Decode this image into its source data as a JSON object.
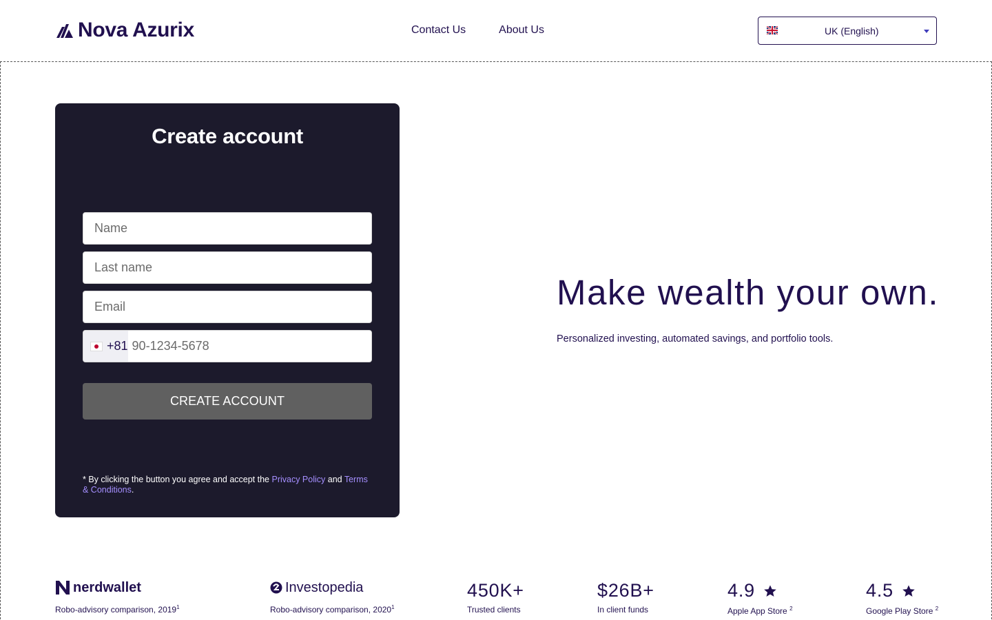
{
  "header": {
    "brand": "Nova Azurix",
    "nav": [
      {
        "label": "Contact Us"
      },
      {
        "label": "About Us"
      }
    ],
    "language": {
      "value": "UK (English)",
      "flag": "uk-flag-icon"
    }
  },
  "form": {
    "title": "Create account",
    "name_placeholder": "Name",
    "lastname_placeholder": "Last name",
    "email_placeholder": "Email",
    "phone_code": "+81",
    "phone_placeholder": "90-1234-5678",
    "submit_label": "CREATE ACCOUNT",
    "legal_prefix": "* By clicking the button you agree and accept the ",
    "privacy_link": "Privacy Policy",
    "legal_and": " and ",
    "terms_link": "Terms & Conditions",
    "legal_suffix": "."
  },
  "hero": {
    "title": "Make wealth your own.",
    "subtitle": "Personalized investing, automated savings, and portfolio tools."
  },
  "stats": {
    "nerdwallet": {
      "logo": "nerdwallet",
      "caption": "Robo-advisory comparison, 2019",
      "sup": "1"
    },
    "investopedia": {
      "logo": "Investopedia",
      "caption": "Robo-advisory comparison, 2020",
      "sup": "1"
    },
    "clients": {
      "value": "450K+",
      "caption": "Trusted clients"
    },
    "funds": {
      "value": "$26B+",
      "caption": "In client funds"
    },
    "appstore": {
      "value": "4.9",
      "caption": "Apple App Store ",
      "sup": "2"
    },
    "playstore": {
      "value": "4.5",
      "caption": "Google Play Store ",
      "sup": "2"
    }
  },
  "colors": {
    "brand": "#21104f",
    "card": "#1c1a2c",
    "button": "#606060",
    "link": "#a58fff"
  }
}
